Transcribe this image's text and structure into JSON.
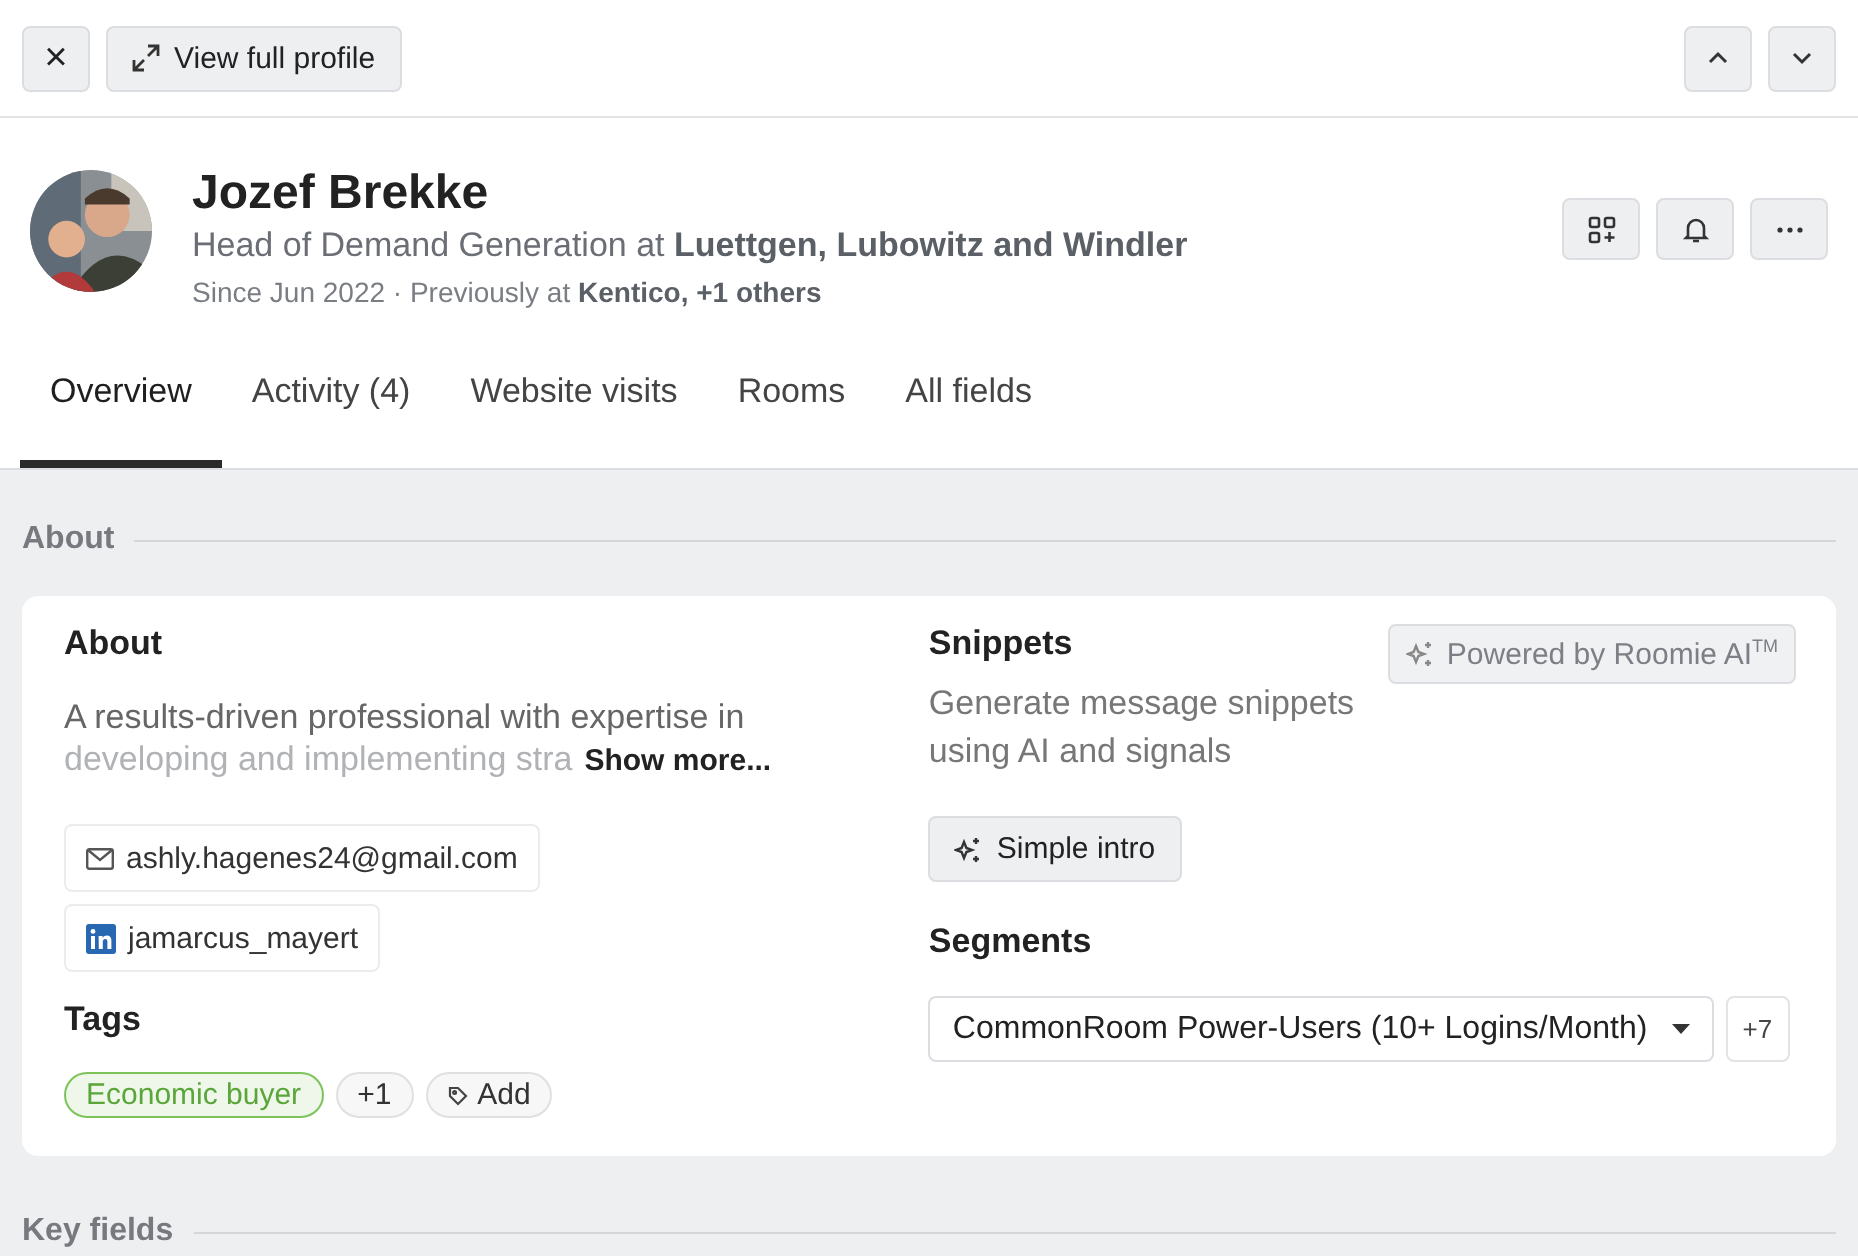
{
  "toolbar": {
    "close": "×",
    "view_full_profile": "View full profile"
  },
  "profile": {
    "name": "Jozef Brekke",
    "headline": "Head of Demand Generation at **Luettgen, Lubowitz and Windler**",
    "history": "Since Jun 2022 · Previously at **Kentico, +1 others**"
  },
  "tabs": [
    {
      "label": "Overview",
      "selected": true
    },
    {
      "label": "Activity (4)",
      "selected": false
    },
    {
      "label": "Website visits",
      "selected": false
    },
    {
      "label": "Rooms",
      "selected": false
    },
    {
      "label": "All fields",
      "selected": false
    }
  ],
  "sections": [
    "About",
    "Key fields"
  ],
  "about": {
    "title": "About",
    "text": [
      "A results-driven professional with expertise in",
      "developing and implementing stra"
    ],
    "show_more": "Show more...",
    "contacts": [
      {
        "kind": "email",
        "value": "ashly.hagenes24@gmail.com"
      },
      {
        "kind": "linkedin",
        "value": "jamarcus_mayert"
      }
    ]
  },
  "tags": {
    "title": "Tags",
    "items": [
      {
        "label": "Economic buyer",
        "color": "#7cc45a"
      }
    ],
    "more": "+1",
    "add": "Add"
  },
  "snippets": {
    "title": "Snippets",
    "description": "Generate message snippets using AI and signals",
    "powered": "Powered by Roomie AI$^{TM}$",
    "action": "Simple intro"
  },
  "segments": {
    "title": "Segments",
    "selected": "CommonRoom Power-Users (10+ Logins/Month)",
    "more": "+7"
  }
}
